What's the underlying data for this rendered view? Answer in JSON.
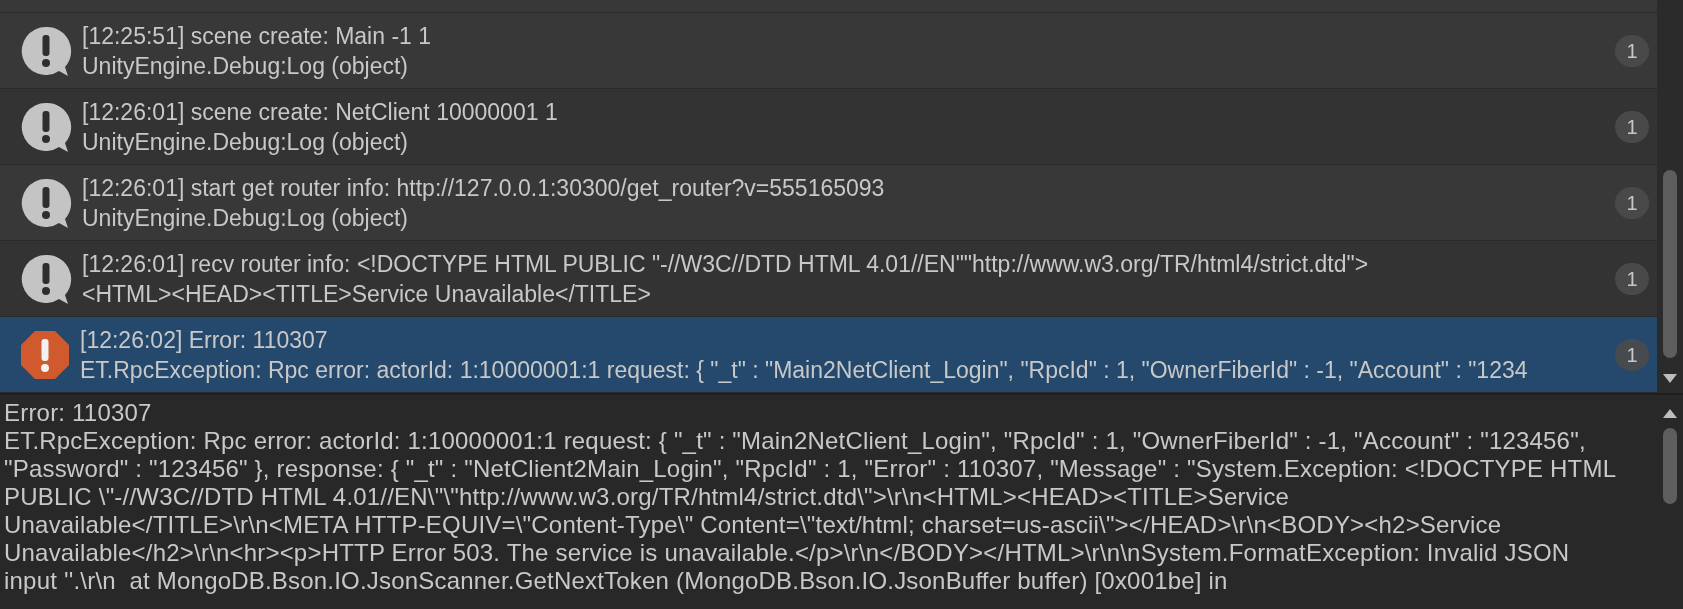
{
  "entries": [
    {
      "kind": "log",
      "selected": false,
      "message": "[12:25:51] scene create: Main -1 1",
      "detail": "UnityEngine.Debug:Log (object)",
      "count": "1"
    },
    {
      "kind": "log",
      "selected": false,
      "message": "[12:26:01] scene create: NetClient 10000001 1",
      "detail": "UnityEngine.Debug:Log (object)",
      "count": "1"
    },
    {
      "kind": "log",
      "selected": false,
      "message": "[12:26:01] start get router info: http://127.0.0.1:30300/get_router?v=555165093",
      "detail": "UnityEngine.Debug:Log (object)",
      "count": "1"
    },
    {
      "kind": "log",
      "selected": false,
      "message": "[12:26:01] recv router info: <!DOCTYPE HTML PUBLIC \"-//W3C//DTD HTML 4.01//EN\"\"http://www.w3.org/TR/html4/strict.dtd\">",
      "detail": "<HTML><HEAD><TITLE>Service Unavailable</TITLE>",
      "count": "1"
    },
    {
      "kind": "error",
      "selected": true,
      "message": "[12:26:02] Error: 110307",
      "detail": "ET.RpcException: Rpc error: actorId: 1:10000001:1 request: { \"_t\" : \"Main2NetClient_Login\", \"RpcId\" : 1, \"OwnerFiberId\" : -1, \"Account\" : \"1234",
      "count": "1"
    }
  ],
  "details": {
    "lines": [
      "Error: 110307",
      "ET.RpcException: Rpc error: actorId: 1:10000001:1 request: { \"_t\" : \"Main2NetClient_Login\", \"RpcId\" : 1, \"OwnerFiberId\" : -1, \"Account\" : \"123456\",",
      "\"Password\" : \"123456\" }, response: { \"_t\" : \"NetClient2Main_Login\", \"RpcId\" : 1, \"Error\" : 110307, \"Message\" : \"System.Exception: <!DOCTYPE HTML",
      "PUBLIC \\\"-//W3C//DTD HTML 4.01//EN\\\"\\\"http://www.w3.org/TR/html4/strict.dtd\\\">\\r\\n<HTML><HEAD><TITLE>Service",
      "Unavailable</TITLE>\\r\\n<META HTTP-EQUIV=\\\"Content-Type\\\" Content=\\\"text/html; charset=us-ascii\\\"></HEAD>\\r\\n<BODY><h2>Service",
      "Unavailable</h2>\\r\\n<hr><p>HTTP Error 503. The service is unavailable.</p>\\r\\n</BODY></HTML>\\r\\n\\nSystem.FormatException: Invalid JSON",
      "input ''.\\r\\n  at MongoDB.Bson.IO.JsonScanner.GetNextToken (MongoDB.Bson.IO.JsonBuffer buffer) [0x001be] in"
    ]
  }
}
